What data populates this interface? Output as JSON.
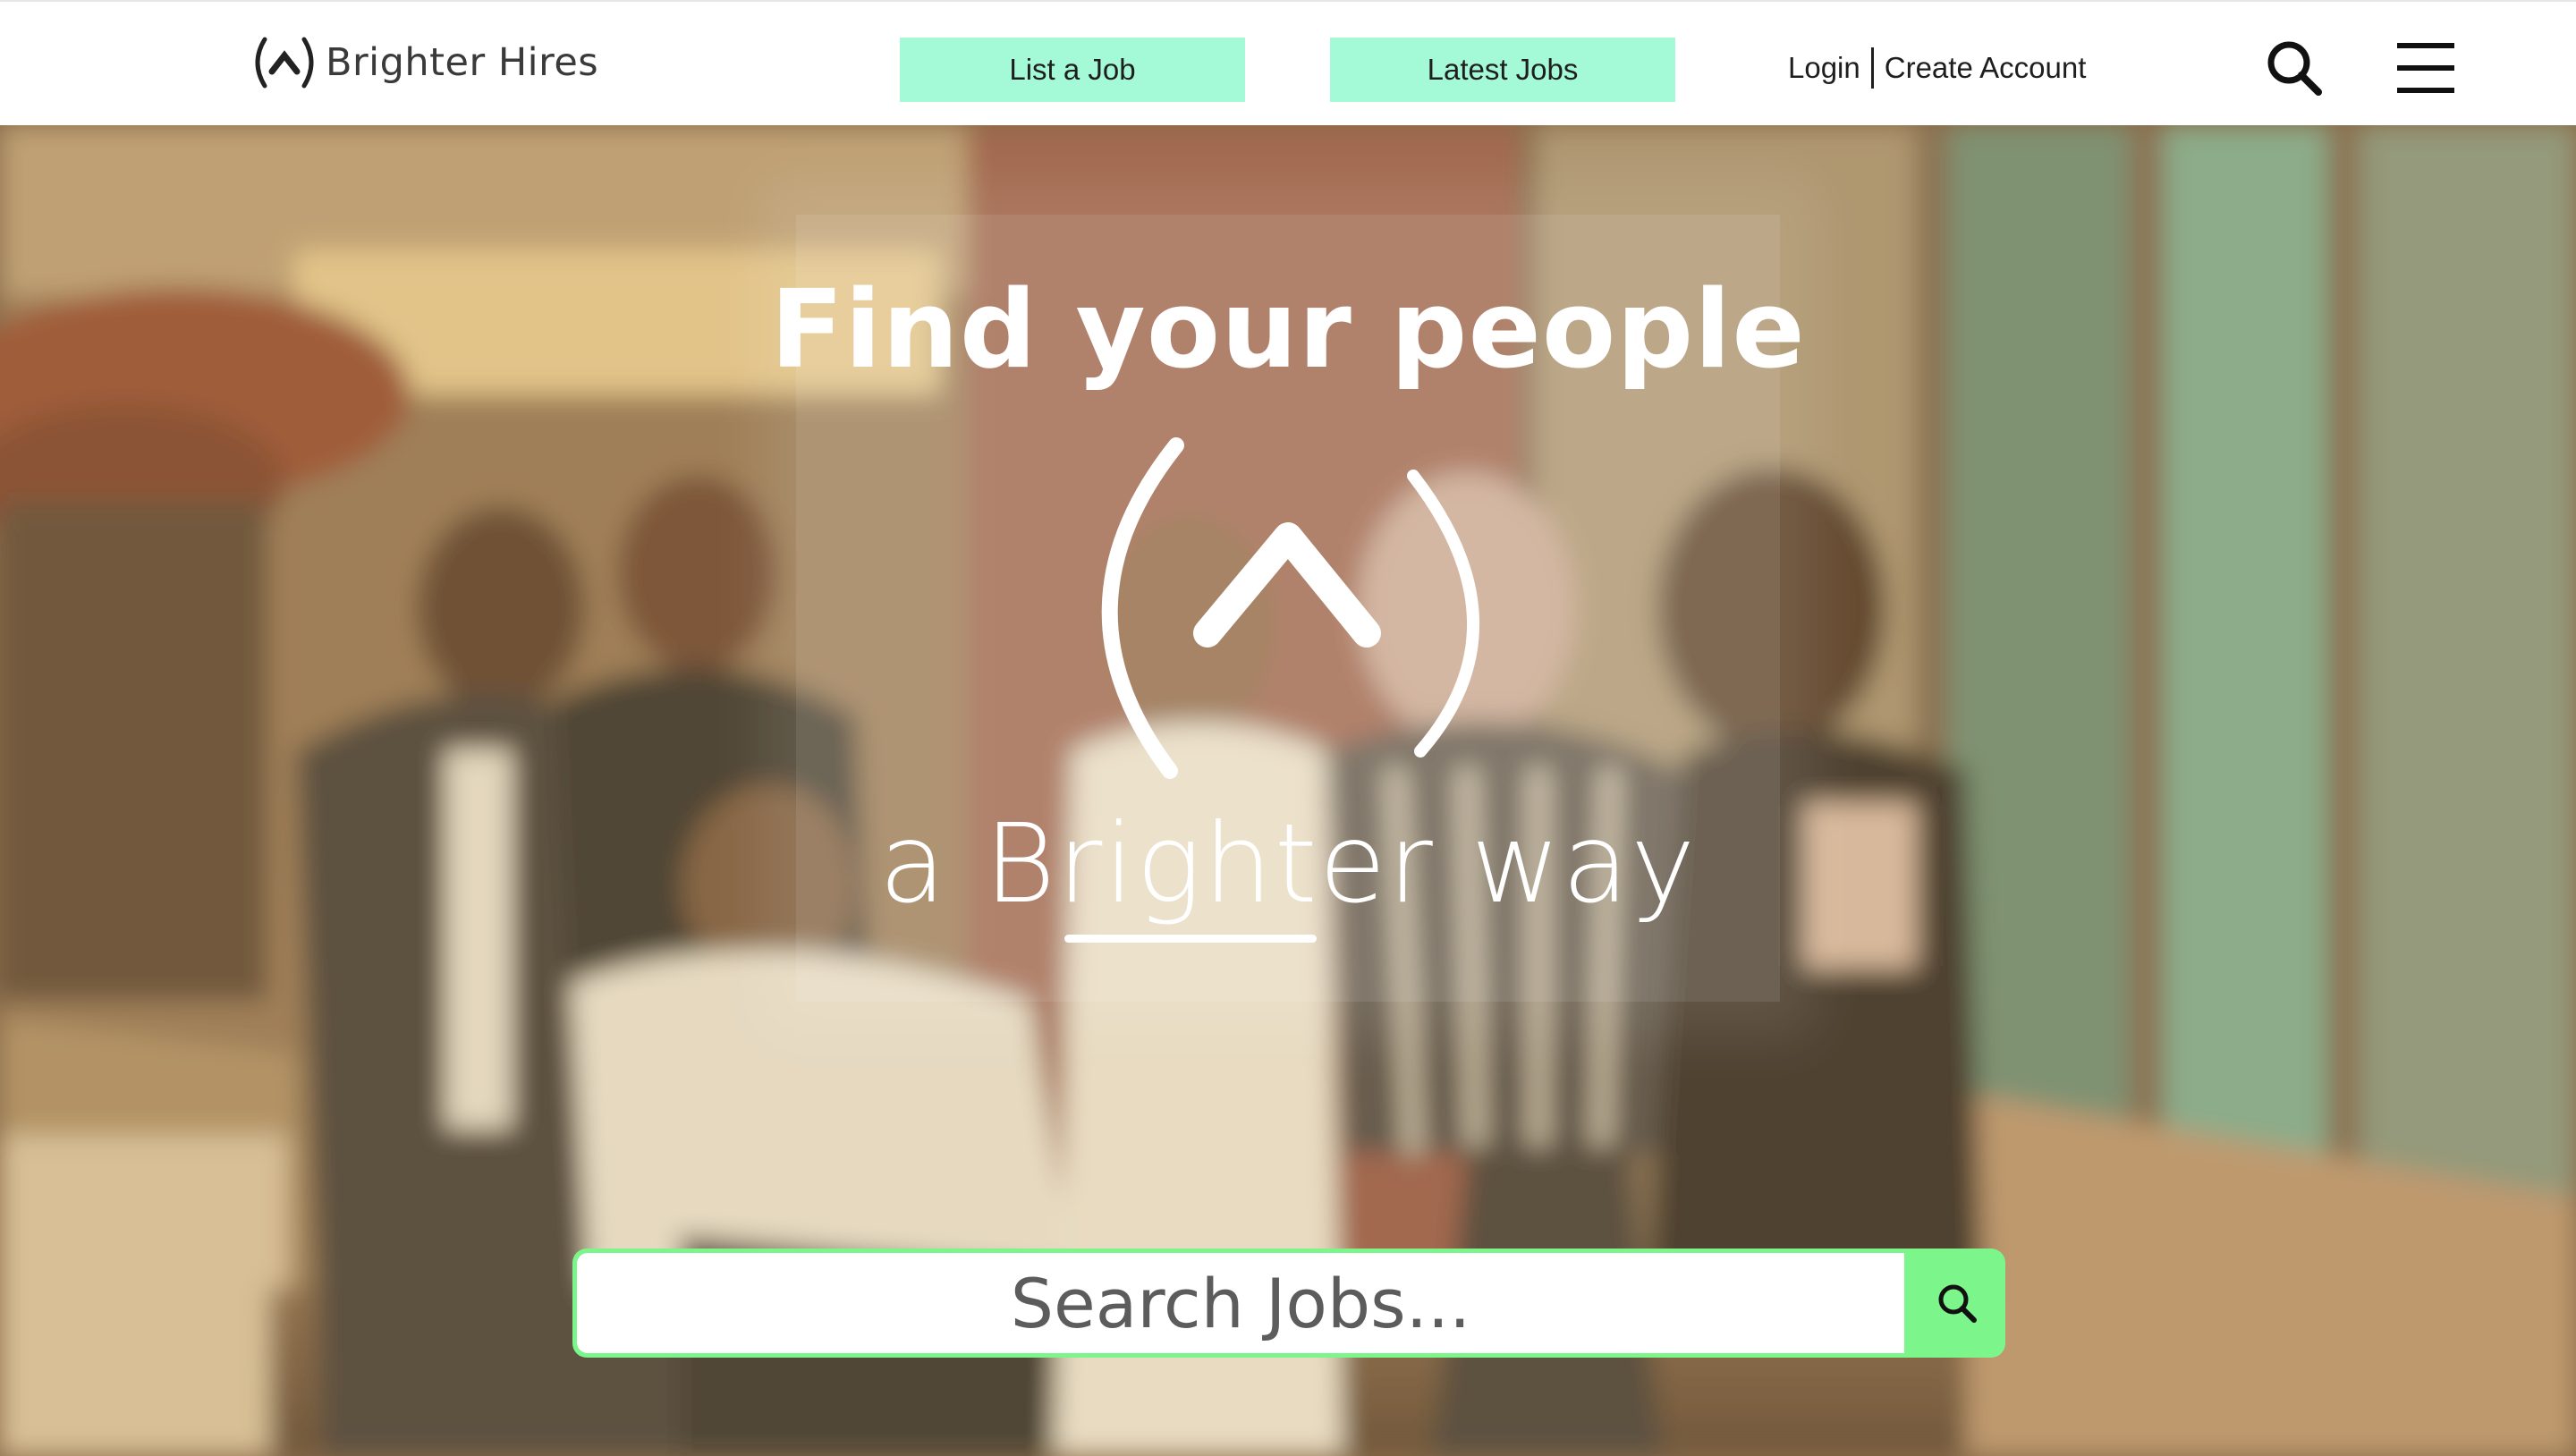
{
  "header": {
    "brand_name": "Brighter Hires",
    "nav": {
      "list_job_label": "List a Job",
      "latest_jobs_label": "Latest Jobs"
    },
    "auth": {
      "login_label": "Login",
      "create_account_label": "Create Account"
    },
    "icons": [
      "logo-icon",
      "search-icon",
      "menu-icon"
    ]
  },
  "hero": {
    "title": "Find your people",
    "tagline": "a Brighter way",
    "overlay_color": "rgba(255,255,255,0.17)"
  },
  "search": {
    "placeholder": "Search Jobs...",
    "button_icon": "search-icon"
  },
  "colors": {
    "nav_button_bg": "#a4fad6",
    "search_accent": "#7cf58a",
    "text_dark": "#1e1e1e"
  }
}
